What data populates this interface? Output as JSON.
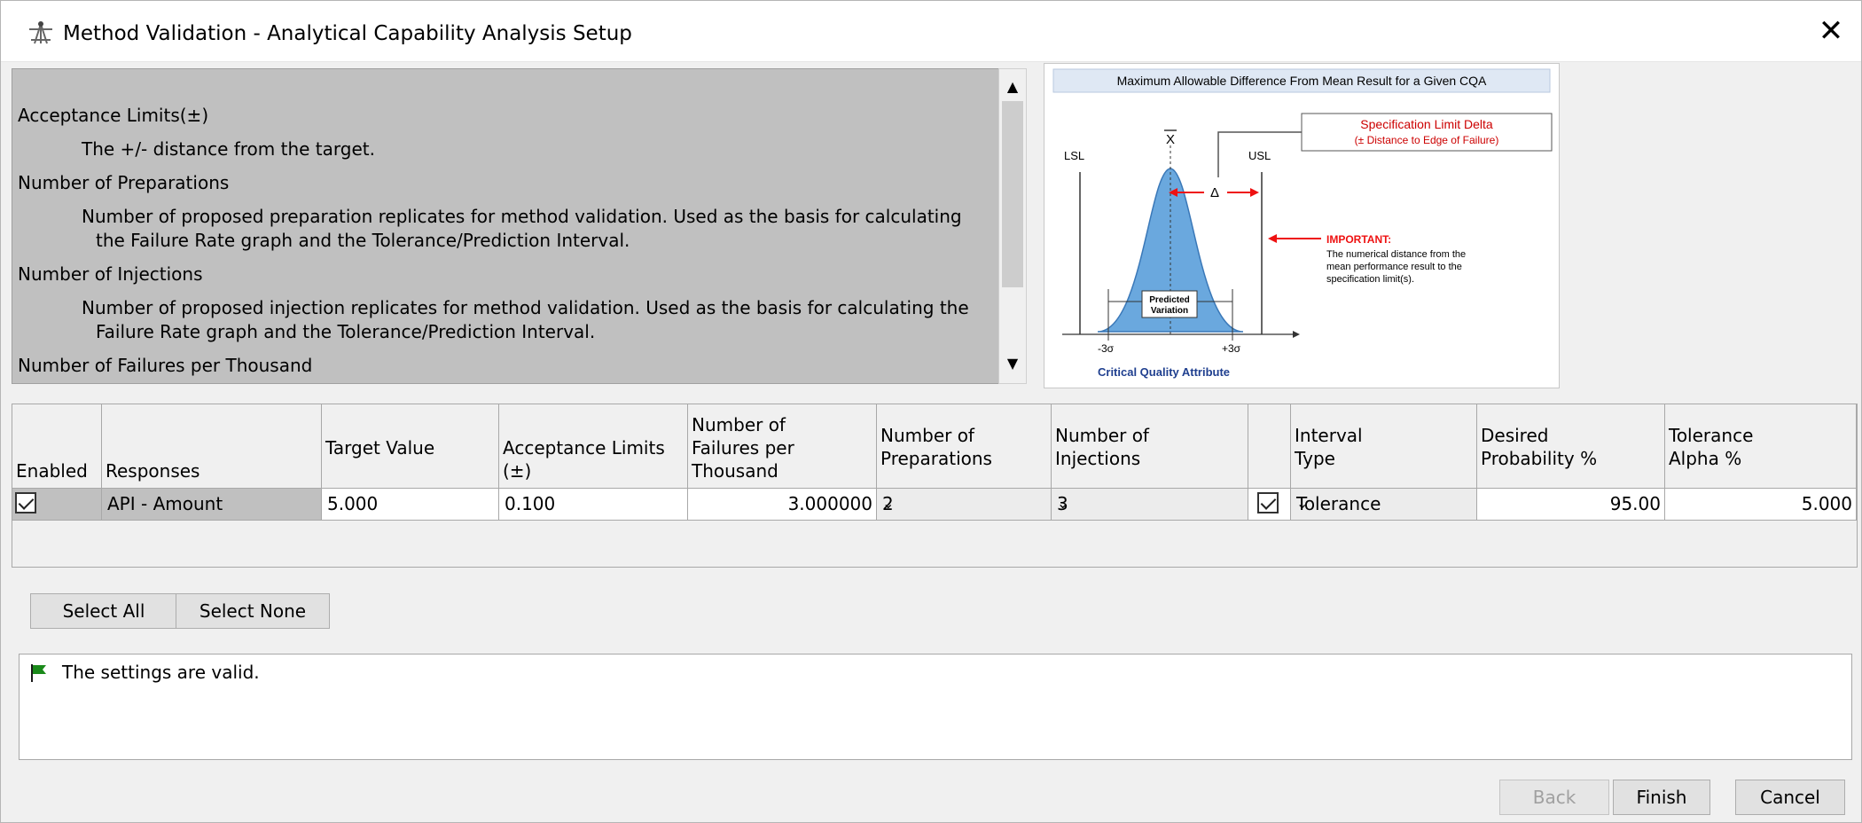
{
  "window": {
    "title": "Method Validation - Analytical Capability Analysis Setup",
    "close_glyph": "✕"
  },
  "help": {
    "lines": [
      "Acceptance Limits(±)",
      "The +/- distance from the target.",
      "Number of Preparations",
      "Number of proposed preparation replicates for method validation. Used as the basis for calculating",
      "the Failure Rate graph and the Tolerance/Prediction Interval.",
      "Number of Injections",
      "Number of proposed injection replicates for method validation. Used as the basis for calculating the",
      "Failure Rate graph and the Tolerance/Prediction Interval.",
      "Number of Failures per Thousand"
    ],
    "scroll_up": "▲",
    "scroll_down": "▼"
  },
  "figure": {
    "title": "Maximum Allowable Difference From Mean Result for a Given CQA",
    "spec_delta": "Specification Limit Delta",
    "spec_delta_sub": "(± Distance to Edge of Failure)",
    "lsl": "LSL",
    "usl": "USL",
    "xbar": "X",
    "delta": "Δ",
    "important": "IMPORTANT:",
    "important_text": [
      "The numerical distance from the",
      "mean performance result to the",
      "specification limit(s)."
    ],
    "predicted": "Predicted",
    "variation": "Variation",
    "minus3": "-3σ",
    "plus3": "+3σ",
    "caption": "Critical Quality Attribute",
    "colors": {
      "curve": "#6aa8de",
      "arrow": "#ee1111",
      "spec_text": "#cc0000",
      "caption": "#1f3f8f",
      "title_bg": "#dfe8f4"
    }
  },
  "grid": {
    "headers": [
      [
        "Enabled"
      ],
      [
        "Responses"
      ],
      [
        "Target Value"
      ],
      [
        "Acceptance Limits",
        "(±)"
      ],
      [
        "Number of",
        "Failures per",
        "Thousand"
      ],
      [
        "Number of",
        "Preparations"
      ],
      [
        "Number of",
        "Injections"
      ],
      [
        ""
      ],
      [
        "Interval",
        "Type"
      ],
      [
        "Desired",
        "Probability %"
      ],
      [
        "Tolerance",
        "Alpha %"
      ]
    ],
    "row": {
      "response": "API - Amount",
      "target": "5.000",
      "acceptance": "0.100",
      "failures": "3.000000",
      "preparations": "2",
      "injections": "3",
      "interval": "Tolerance",
      "probability": "95.00",
      "alpha": "5.000",
      "dropdown_glyph": "⌄"
    }
  },
  "buttons": {
    "select_all": "Select All",
    "select_none": "Select None",
    "back": "Back",
    "finish": "Finish",
    "cancel": "Cancel"
  },
  "status": {
    "message": "The settings are valid.",
    "flag_color": "#1a8a1a"
  }
}
